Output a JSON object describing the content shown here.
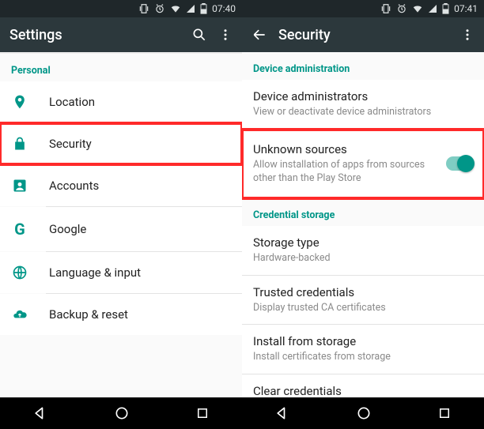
{
  "colors": {
    "accent": "#009688",
    "highlight": "#ff2a2a",
    "appbar": "#2c383c",
    "statusbar": "#1f272a"
  },
  "left": {
    "status_time": "07:40",
    "appbar_title": "Settings",
    "section_personal": "Personal",
    "items": [
      {
        "label": "Location",
        "icon": "location-icon"
      },
      {
        "label": "Security",
        "icon": "lock-icon"
      },
      {
        "label": "Accounts",
        "icon": "account-icon"
      },
      {
        "label": "Google",
        "icon": "google-icon"
      },
      {
        "label": "Language & input",
        "icon": "globe-icon"
      },
      {
        "label": "Backup & reset",
        "icon": "backup-icon"
      }
    ]
  },
  "right": {
    "status_time": "07:41",
    "appbar_title": "Security",
    "section_device_admin": "Device administration",
    "section_cred_storage": "Credential storage",
    "device_admins": {
      "title": "Device administrators",
      "sub": "View or deactivate device administrators"
    },
    "unknown_sources": {
      "title": "Unknown sources",
      "sub": "Allow installation of apps from sources other than the Play Store",
      "enabled": true
    },
    "storage_type": {
      "title": "Storage type",
      "sub": "Hardware-backed"
    },
    "trusted_creds": {
      "title": "Trusted credentials",
      "sub": "Display trusted CA certificates"
    },
    "install_storage": {
      "title": "Install from storage",
      "sub": "Install certificates from storage"
    },
    "clear_creds": {
      "title": "Clear credentials"
    }
  }
}
